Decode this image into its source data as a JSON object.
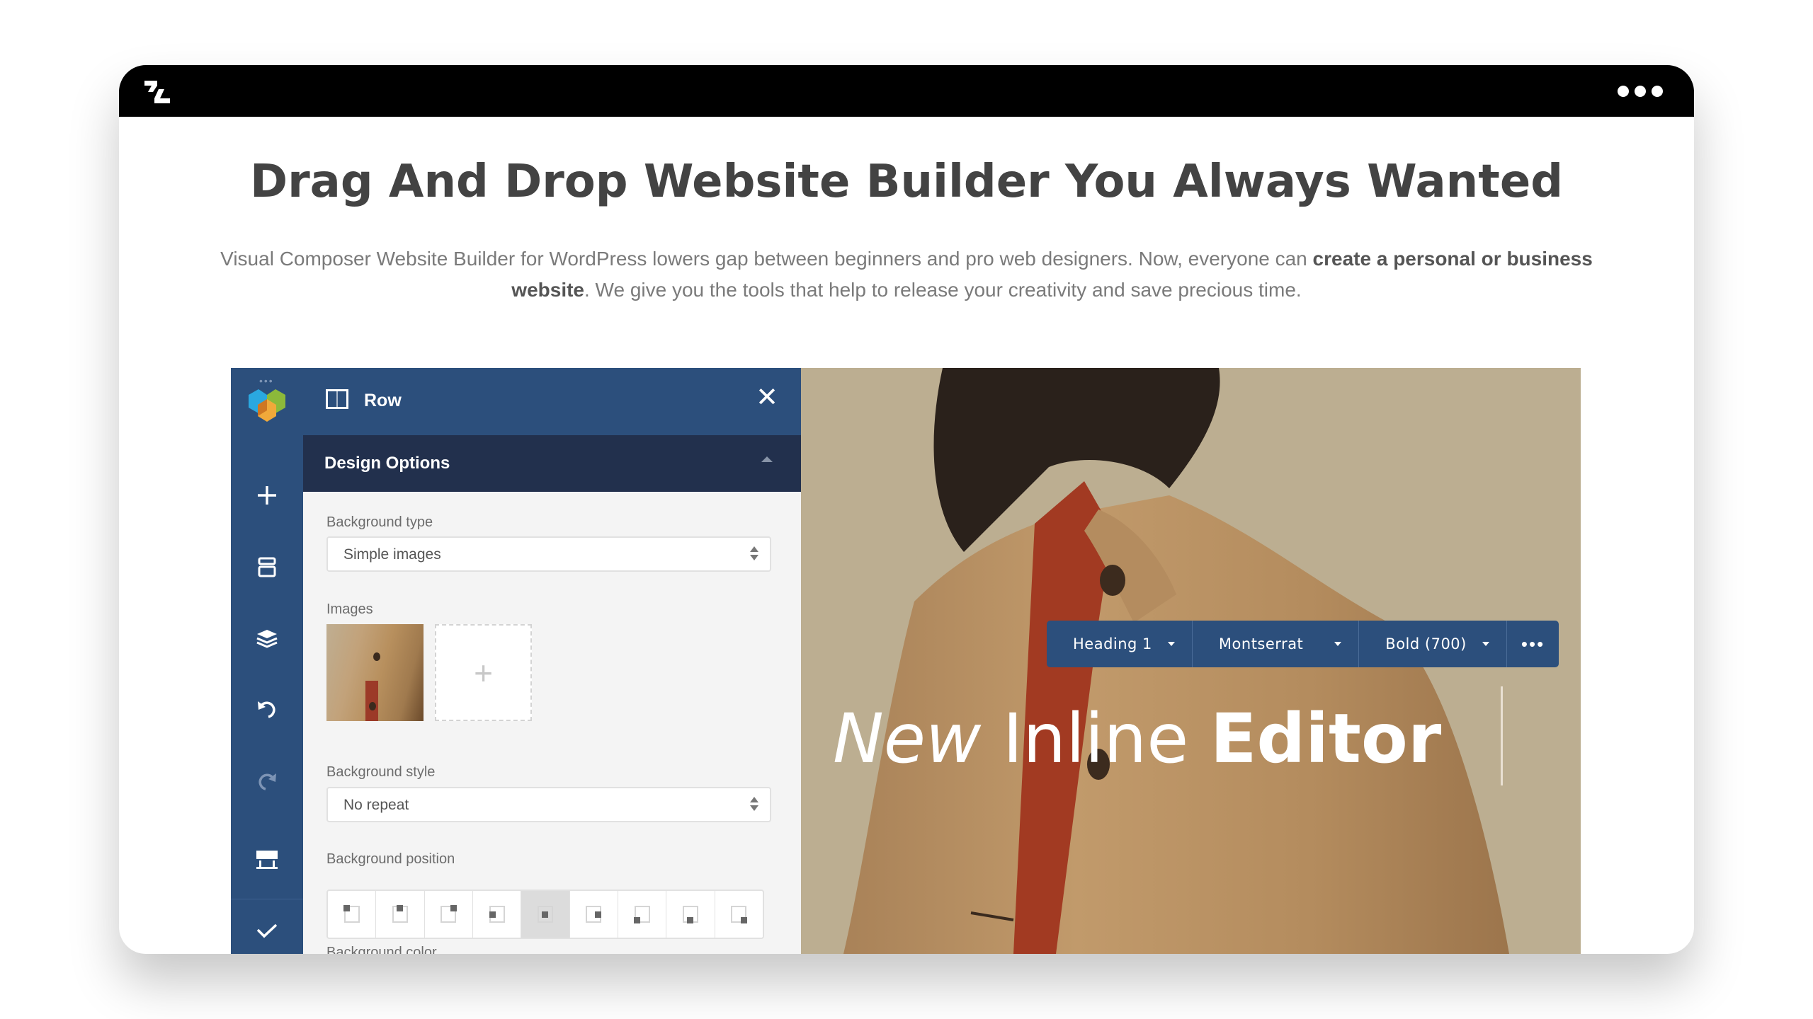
{
  "window": {
    "logo": "zl-logo-icon",
    "menu_icon": "more-dots-icon"
  },
  "hero": {
    "title": "Drag And Drop Website Builder You Always Wanted",
    "lead_part1": "Visual Composer Website Builder for WordPress lowers gap between beginners and pro web designers. Now, everyone can ",
    "lead_bold": "create a personal or business website",
    "lead_part2": ". We give you the tools that help to release your creativity and save precious time."
  },
  "editor": {
    "sidebar": {
      "items": [
        {
          "icon": "vc-logo-icon"
        },
        {
          "icon": "add-element-icon"
        },
        {
          "icon": "templates-icon"
        },
        {
          "icon": "tree-view-layers-icon"
        },
        {
          "icon": "undo-icon"
        },
        {
          "icon": "redo-icon",
          "disabled": true
        },
        {
          "icon": "settings-icon"
        },
        {
          "icon": "publish-check-icon"
        }
      ]
    },
    "panel": {
      "title": "Row",
      "section_title": "Design Options",
      "background_type_label": "Background type",
      "background_type_value": "Simple images",
      "images_label": "Images",
      "add_image_symbol": "+",
      "background_style_label": "Background style",
      "background_style_value": "No repeat",
      "background_position_label": "Background position",
      "background_positions": [
        "top-left",
        "top-center",
        "top-right",
        "center-left",
        "center-center",
        "center-right",
        "bottom-left",
        "bottom-center",
        "bottom-right"
      ],
      "background_position_selected": "center-center",
      "background_color_label": "Background color"
    },
    "inline_toolbar": {
      "element_type": "Heading 1",
      "font_family": "Montserrat",
      "font_weight": "Bold (700)",
      "more": "•••"
    },
    "inline_text": {
      "italic": "New",
      "light": " Inline ",
      "bold": "Editor"
    }
  },
  "colors": {
    "topbar": "#000000",
    "editor_blue": "#2c4f7c",
    "section_dark": "#22304d",
    "heading_text": "#434343",
    "body_text": "#7a7a7a"
  }
}
